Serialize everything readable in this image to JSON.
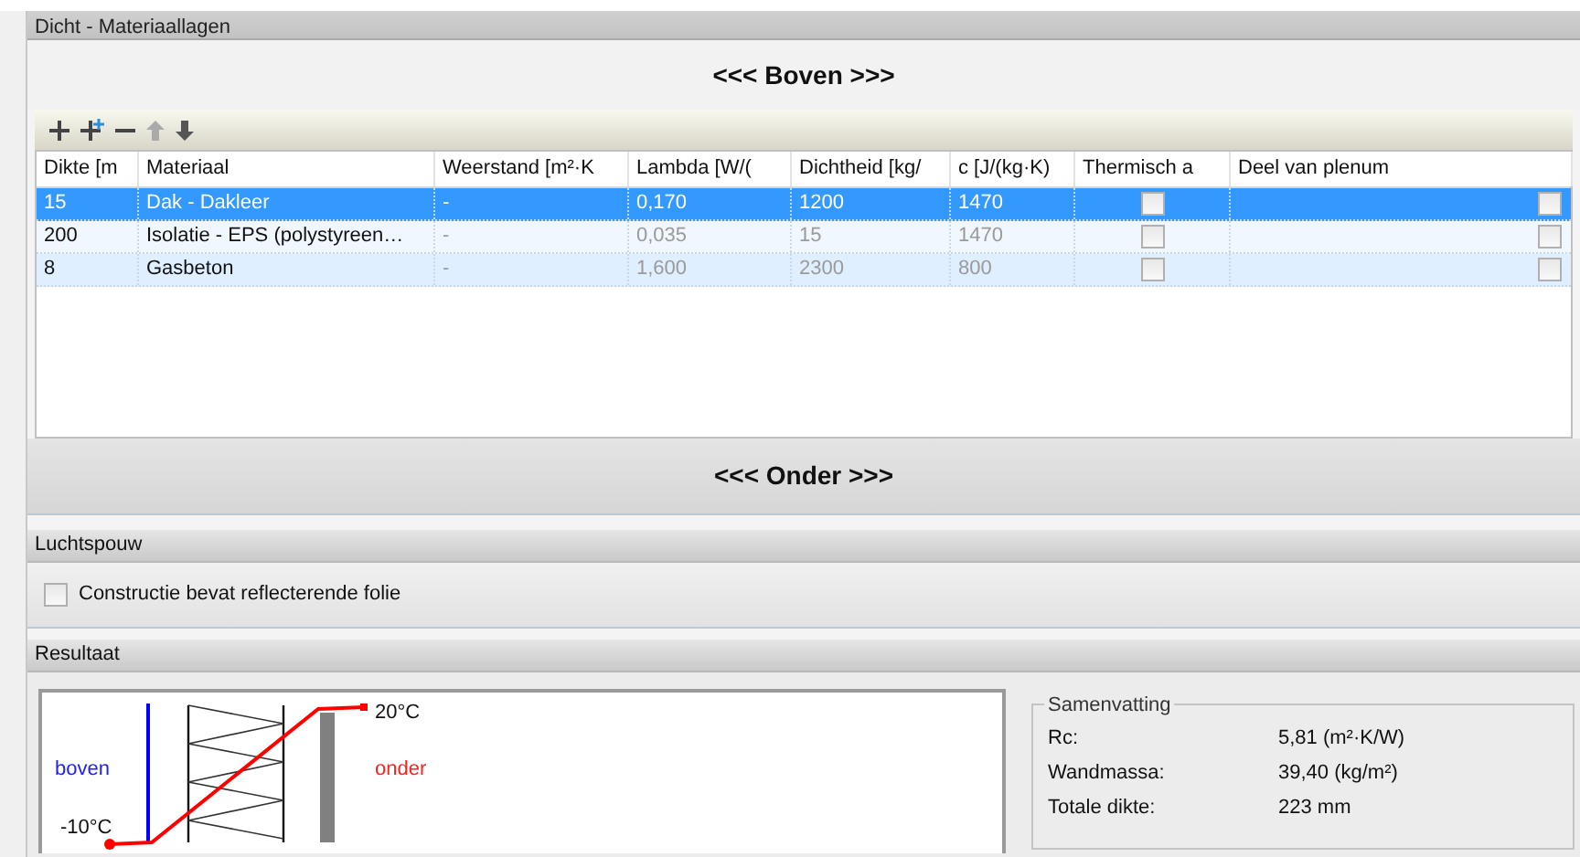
{
  "layers_panel": {
    "title": "Dicht - Materiaallagen",
    "top_label": "<<< Boven >>>",
    "bottom_label": "<<< Onder >>>",
    "columns": [
      "Dikte [m",
      "Materiaal",
      "Weerstand [m²·K",
      "Lambda [W/(",
      "Dichtheid [kg/",
      "c [J/(kg·K)",
      "Thermisch a",
      "Deel van plenum"
    ],
    "rows": [
      {
        "selected": true,
        "dikte": "15",
        "materiaal": "Dak - Dakleer",
        "weerstand": "-",
        "lambda": "0,170",
        "dichtheid": "1200",
        "c": "1470",
        "thermisch": false,
        "plenum": false
      },
      {
        "selected": false,
        "dikte": "200",
        "materiaal": "Isolatie - EPS (polystyreen…",
        "weerstand": "-",
        "lambda": "0,035",
        "dichtheid": "15",
        "c": "1470",
        "thermisch": false,
        "plenum": false
      },
      {
        "selected": false,
        "dikte": "8",
        "materiaal": "Gasbeton",
        "weerstand": "-",
        "lambda": "1,600",
        "dichtheid": "2300",
        "c": "800",
        "thermisch": false,
        "plenum": false
      }
    ]
  },
  "air_gap_panel": {
    "title": "Luchtspouw",
    "reflective_foil": {
      "label": "Constructie bevat reflecterende folie",
      "checked": false
    }
  },
  "result_panel": {
    "title": "Resultaat",
    "diagram": {
      "top_side": "boven",
      "bottom_side": "onder",
      "warm_temp": "20°C",
      "cold_temp": "-10°C"
    },
    "summary": {
      "title": "Samenvatting",
      "rows": [
        {
          "label": "Rc:",
          "value": "5,81 (m²·K/W)"
        },
        {
          "label": "Wandmassa:",
          "value": "39,40 (kg/m²)"
        },
        {
          "label": "Totale dikte:",
          "value": "223 mm"
        }
      ]
    }
  }
}
